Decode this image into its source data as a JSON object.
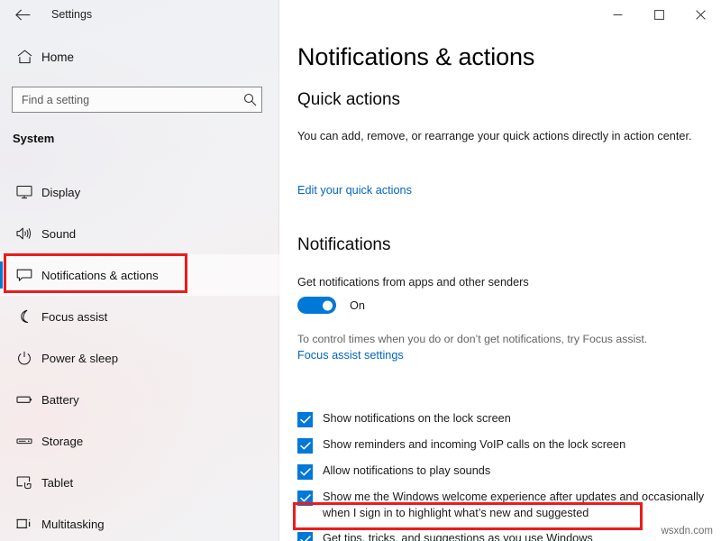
{
  "titlebar": {
    "back_icon": "back-arrow-icon",
    "title": "Settings",
    "minimize": "–",
    "maximize": "□",
    "close": "✕"
  },
  "sidebar": {
    "home_label": "Home",
    "home_icon": "home-icon",
    "search": {
      "placeholder": "Find a setting",
      "value": "",
      "icon": "search-icon"
    },
    "section_label": "System",
    "items": [
      {
        "label": "Display",
        "icon": "monitor-icon",
        "selected": false
      },
      {
        "label": "Sound",
        "icon": "speaker-icon",
        "selected": false
      },
      {
        "label": "Notifications & actions",
        "icon": "chat-bubble-icon",
        "selected": true
      },
      {
        "label": "Focus assist",
        "icon": "moon-icon",
        "selected": false
      },
      {
        "label": "Power & sleep",
        "icon": "power-icon",
        "selected": false
      },
      {
        "label": "Battery",
        "icon": "battery-icon",
        "selected": false
      },
      {
        "label": "Storage",
        "icon": "storage-icon",
        "selected": false
      },
      {
        "label": "Tablet",
        "icon": "tablet-icon",
        "selected": false
      },
      {
        "label": "Multitasking",
        "icon": "multitasking-icon",
        "selected": false
      }
    ]
  },
  "main": {
    "page_title": "Notifications & actions",
    "quick_actions": {
      "heading": "Quick actions",
      "description": "You can add, remove, or rearrange your quick actions directly in action center.",
      "link": "Edit your quick actions"
    },
    "notifications": {
      "heading": "Notifications",
      "toggle_label": "Get notifications from apps and other senders",
      "toggle_state": "On",
      "toggle_on": true,
      "hint": "To control times when you do or don’t get notifications, try Focus assist.",
      "hint_link": "Focus assist settings",
      "checkboxes": [
        {
          "label": "Show notifications on the lock screen",
          "checked": true
        },
        {
          "label": "Show reminders and incoming VoIP calls on the lock screen",
          "checked": true
        },
        {
          "label": "Allow notifications to play sounds",
          "checked": true
        },
        {
          "label": "Show me the Windows welcome experience after updates and occasionally when I sign in to highlight what’s new and suggested",
          "checked": true
        },
        {
          "label": "Get tips, tricks, and suggestions as you use Windows",
          "checked": true
        }
      ]
    }
  },
  "annotations": {
    "color": "#ee1b1b",
    "sidebar_target": "Notifications & actions",
    "checkbox_target": "Get tips, tricks, and suggestions as you use Windows"
  },
  "watermark": "wsxdn.com",
  "colors": {
    "accent": "#0078d7",
    "link": "#0067c0",
    "annotation": "#ee1b1b"
  }
}
